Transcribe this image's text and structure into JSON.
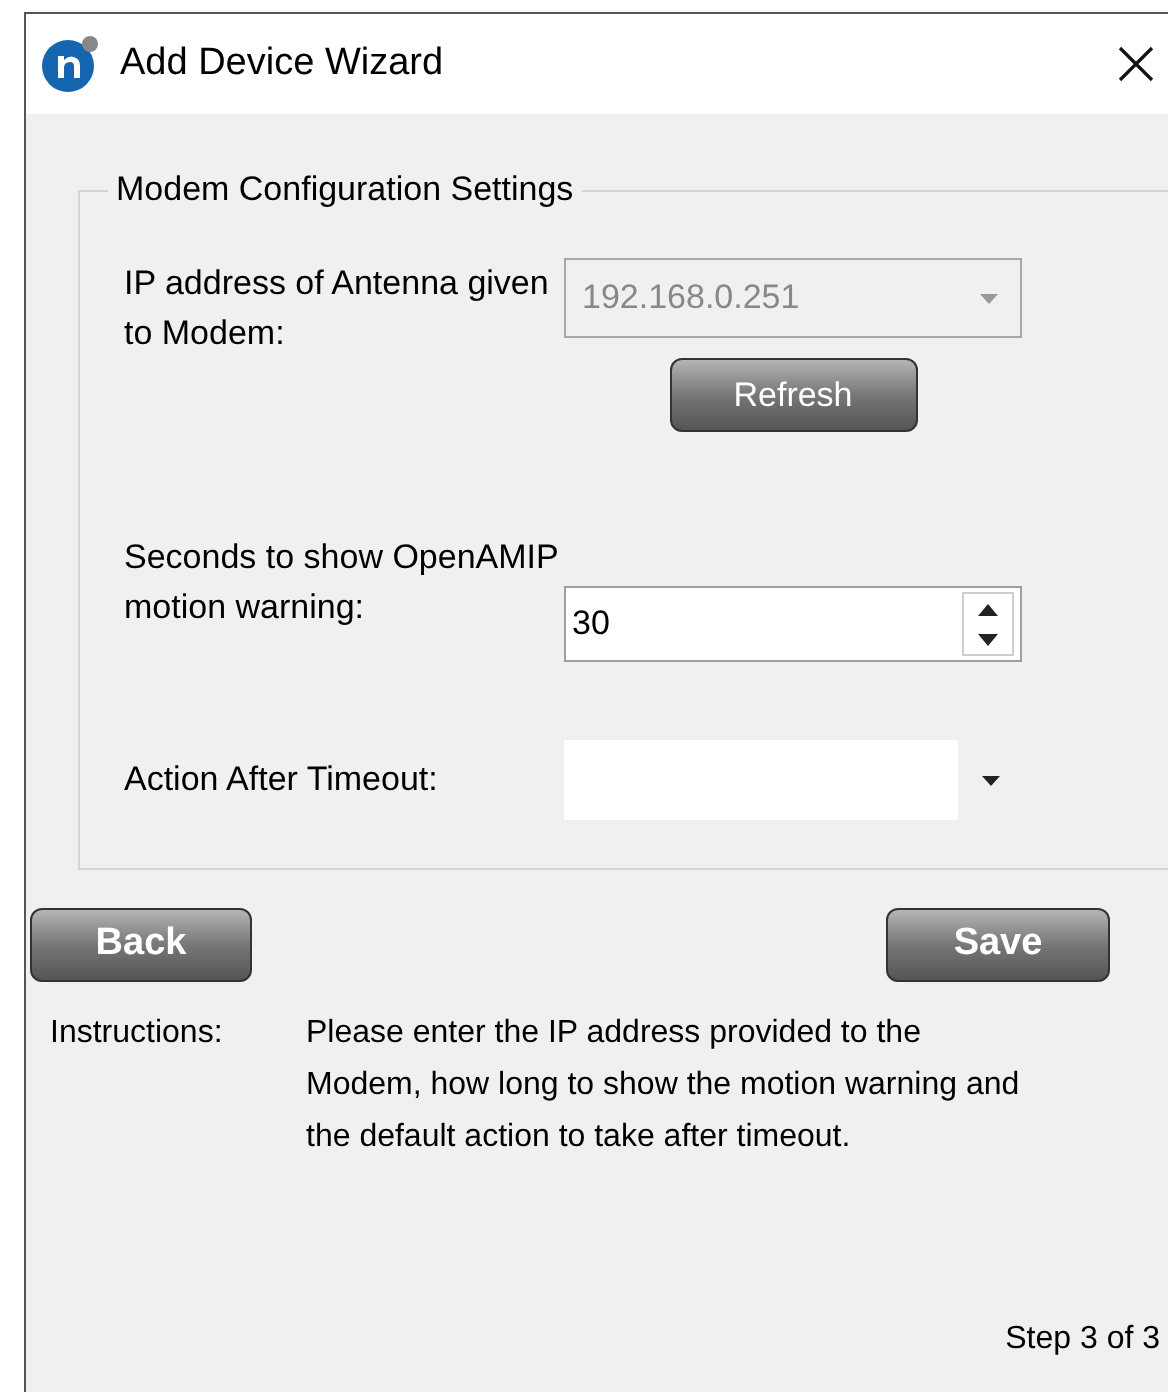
{
  "window": {
    "title": "Add Device Wizard"
  },
  "group": {
    "title": "Modem Configuration Settings",
    "fields": [
      {
        "kind": "combo",
        "label": "IP address of Antenna given to Modem:",
        "value": "192.168.0.251",
        "disabled": true,
        "button": "Refresh"
      },
      {
        "kind": "spin",
        "label": "Seconds to show OpenAMIP motion warning:",
        "value": "30",
        "disabled": false
      },
      {
        "kind": "combo",
        "label": "Action After Timeout:",
        "disabled": false
      }
    ]
  },
  "buttons": {
    "back": "Back",
    "save": "Save"
  },
  "instructions": {
    "label": "Instructions:",
    "text": "Please enter the IP address provided to the Modem, how long to show the motion warning and the default action to take after timeout."
  },
  "step": "Step 3 of 3"
}
